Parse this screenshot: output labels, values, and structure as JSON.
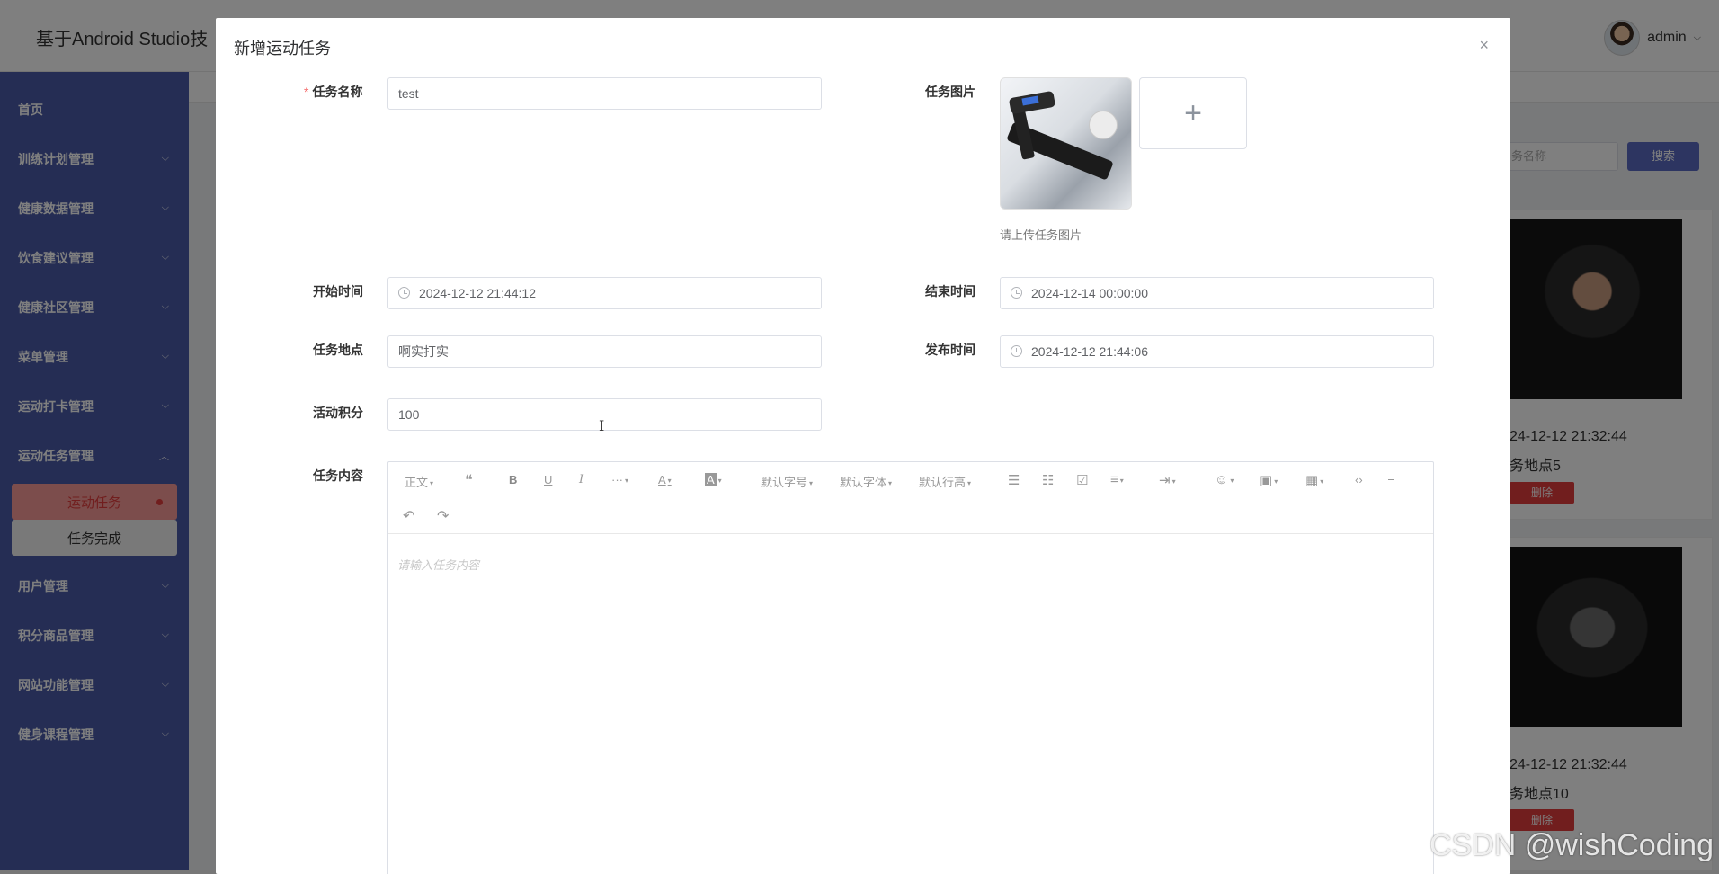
{
  "app": {
    "title": "基于Android Studio技",
    "user": "admin",
    "user_caret": "⌵"
  },
  "sidebar": {
    "items": [
      {
        "label": "首页",
        "arrow": ""
      },
      {
        "label": "训练计划管理",
        "arrow": "⌵"
      },
      {
        "label": "健康数据管理",
        "arrow": "⌵"
      },
      {
        "label": "饮食建议管理",
        "arrow": "⌵"
      },
      {
        "label": "健康社区管理",
        "arrow": "⌵"
      },
      {
        "label": "菜单管理",
        "arrow": "⌵"
      },
      {
        "label": "运动打卡管理",
        "arrow": "⌵"
      },
      {
        "label": "运动任务管理",
        "arrow": "︿"
      }
    ],
    "subitems": [
      {
        "label": "运动任务",
        "active": true
      },
      {
        "label": "任务完成",
        "active": false
      }
    ],
    "items_after": [
      {
        "label": "用户管理",
        "arrow": "⌵"
      },
      {
        "label": "积分商品管理",
        "arrow": "⌵"
      },
      {
        "label": "网站功能管理",
        "arrow": "⌵"
      },
      {
        "label": "健身课程管理",
        "arrow": "⌵"
      }
    ]
  },
  "background": {
    "search_placeholder": "务名称",
    "search_button": "搜索",
    "cards": [
      {
        "date": "24-12-12 21:32:44",
        "place": "务地点5",
        "delete": "删除"
      },
      {
        "date": "24-12-12 21:32:44",
        "place": "务地点10",
        "delete": "删除"
      }
    ]
  },
  "dialog": {
    "title": "新增运动任务",
    "close_icon": "×",
    "fields": {
      "name": {
        "required_mark": "*",
        "label": "任务名称",
        "value": "test"
      },
      "image": {
        "label": "任务图片",
        "upload_icon": "+",
        "tip": "请上传任务图片"
      },
      "start": {
        "label": "开始时间",
        "value": "2024-12-12 21:44:12"
      },
      "end": {
        "label": "结束时间",
        "value": "2024-12-14 00:00:00"
      },
      "place": {
        "label": "任务地点",
        "value": "啊实打实"
      },
      "publish": {
        "label": "发布时间",
        "value": "2024-12-12 21:44:06"
      },
      "points": {
        "label": "活动积分",
        "value": "100"
      },
      "content": {
        "label": "任务内容",
        "placeholder": "请输入任务内容"
      }
    },
    "editor_toolbar": {
      "paragraph": "正文",
      "quote": "❝",
      "bold": "B",
      "underline": "U",
      "italic": "I",
      "more": "···",
      "font_color": "A",
      "bg_color": "A",
      "font_size": "默认字号",
      "font_family": "默认字体",
      "line_height": "默认行高",
      "bullet_list": "☰",
      "numbered_list": "☷",
      "todo": "☑",
      "align": "≡",
      "indent": "⇥",
      "emoji": "☺",
      "image": "▣",
      "table": "▦",
      "code": "‹›",
      "divider": "⎯",
      "undo": "↶",
      "redo": "↷",
      "caret": "▾"
    }
  },
  "watermark": "CSDN @wishCoding",
  "colors": {
    "sidebar_bg": "#4a5aa8",
    "active_text": "#e23c3c",
    "active_bg": "#f89a98",
    "button_primary": "#5b6bc2",
    "required": "#f56c6c"
  }
}
